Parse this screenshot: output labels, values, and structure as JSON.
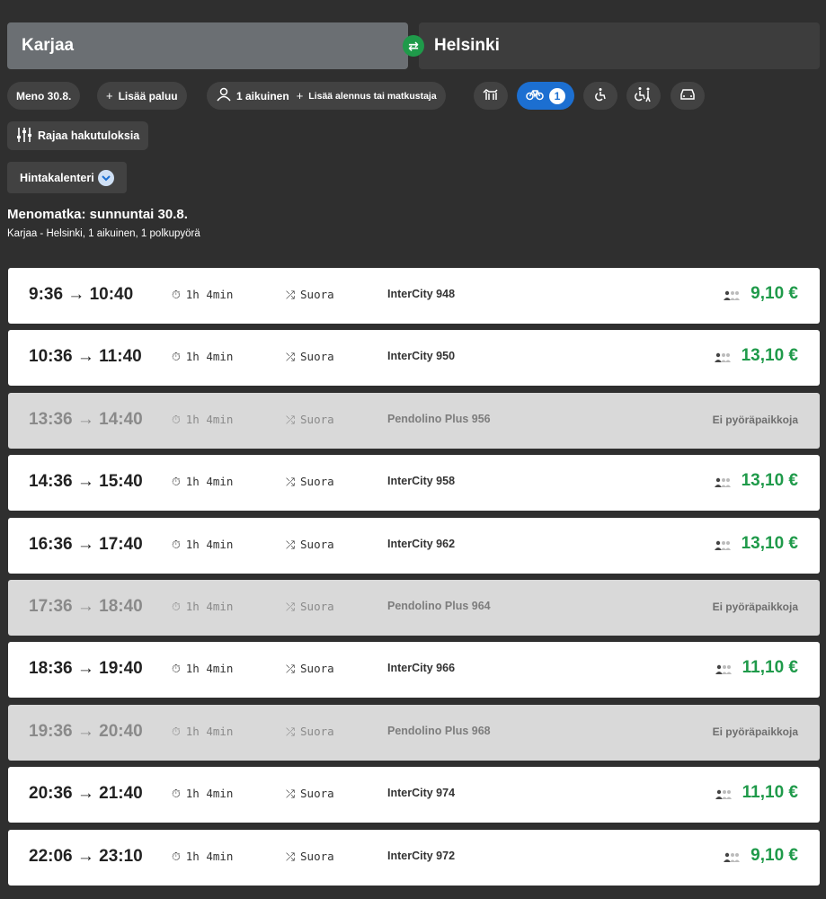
{
  "search": {
    "from": "Karjaa",
    "to": "Helsinki",
    "swap_icon": "swap-icon"
  },
  "chips": {
    "date": "Meno 30.8.",
    "add_return": "Lisää paluu",
    "passengers": "1 aikuinen",
    "add_discount": "Lisää alennus tai matkustaja",
    "bike_count": "1",
    "icons": [
      "pet-icon",
      "bicycle-icon",
      "wheelchair-icon",
      "wheelchair-assist-icon",
      "car-icon"
    ]
  },
  "filter": {
    "label": "Rajaa hakutuloksia"
  },
  "calendar": {
    "label": "Hintakalenteri"
  },
  "journey": {
    "title": "Menomatka: sunnuntai 30.8.",
    "subtitle": "Karjaa - Helsinki, 1 aikuinen, 1 polkupyörä"
  },
  "colors": {
    "price_green": "#1f9a4a",
    "accent_blue": "#1c6fd1"
  },
  "results": [
    {
      "times": "9:36 → 10:40",
      "duration": "1h 4min",
      "direct": "Suora",
      "train": "InterCity 948",
      "price": "9,10 €",
      "available": true
    },
    {
      "times": "10:36 → 11:40",
      "duration": "1h 4min",
      "direct": "Suora",
      "train": "InterCity 950",
      "price": "13,10 €",
      "available": true
    },
    {
      "times": "13:36 → 14:40",
      "duration": "1h 4min",
      "direct": "Suora",
      "train": "Pendolino Plus 956",
      "price": "Ei pyöräpaikkoja",
      "available": false
    },
    {
      "times": "14:36 → 15:40",
      "duration": "1h 4min",
      "direct": "Suora",
      "train": "InterCity 958",
      "price": "13,10 €",
      "available": true
    },
    {
      "times": "16:36 → 17:40",
      "duration": "1h 4min",
      "direct": "Suora",
      "train": "InterCity 962",
      "price": "13,10 €",
      "available": true
    },
    {
      "times": "17:36 → 18:40",
      "duration": "1h 4min",
      "direct": "Suora",
      "train": "Pendolino Plus 964",
      "price": "Ei pyöräpaikkoja",
      "available": false
    },
    {
      "times": "18:36 → 19:40",
      "duration": "1h 4min",
      "direct": "Suora",
      "train": "InterCity 966",
      "price": "11,10 €",
      "available": true
    },
    {
      "times": "19:36 → 20:40",
      "duration": "1h 4min",
      "direct": "Suora",
      "train": "Pendolino Plus 968",
      "price": "Ei pyöräpaikkoja",
      "available": false
    },
    {
      "times": "20:36 → 21:40",
      "duration": "1h 4min",
      "direct": "Suora",
      "train": "InterCity 974",
      "price": "11,10 €",
      "available": true
    },
    {
      "times": "22:06 → 23:10",
      "duration": "1h 4min",
      "direct": "Suora",
      "train": "InterCity 972",
      "price": "9,10 €",
      "available": true
    }
  ]
}
